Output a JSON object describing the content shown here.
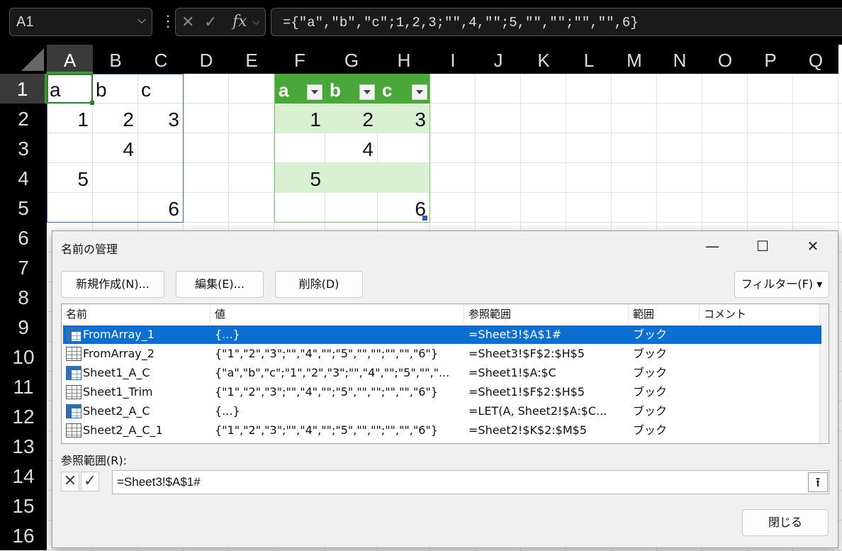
{
  "formula_bar": {
    "name_box": "A1",
    "cancel_icon": "✕",
    "enter_icon": "✓",
    "fx_label": "fx",
    "formula": "={\"a\",\"b\",\"c\";1,2,3;\"\",4,\"\";5,\"\",\"\";\"\",\"\",6}"
  },
  "sheet": {
    "columns": [
      "A",
      "B",
      "C",
      "D",
      "E",
      "F",
      "G",
      "H",
      "I",
      "J",
      "K",
      "L",
      "M",
      "N",
      "O",
      "P",
      "Q"
    ],
    "rows": [
      "1",
      "2",
      "3",
      "4",
      "5",
      "6",
      "7",
      "8",
      "9",
      "10",
      "11",
      "12",
      "13",
      "14",
      "15",
      "16"
    ],
    "spill_cells": {
      "A1": "a",
      "B1": "b",
      "C1": "c",
      "A2": "1",
      "B2": "2",
      "C2": "3",
      "B3": "4",
      "A4": "5",
      "C5": "6"
    },
    "table_headers": [
      "a",
      "b",
      "c"
    ],
    "table_cells": {
      "F2": "1",
      "G2": "2",
      "H2": "3",
      "G3": "4",
      "F4": "5",
      "H5": "6"
    },
    "table_color": "#4aa83a",
    "band_color": "#d9f0d3"
  },
  "dialog": {
    "title": "名前の管理",
    "minimize": "—",
    "maximize": "☐",
    "close": "✕",
    "buttons": {
      "new": "新規作成(N)...",
      "edit": "編集(E)...",
      "delete": "削除(D)",
      "filter": "フィルター(F) ▾"
    },
    "columns": {
      "name": "名前",
      "value": "値",
      "refers_to": "参照範囲",
      "scope": "範囲",
      "comment": "コメント"
    },
    "items": [
      {
        "name": "FromArray_1",
        "value": "{...}",
        "refers_to": "=Sheet3!$A$1#",
        "scope": "ブック",
        "icon": "named-range-icon"
      },
      {
        "name": "FromArray_2",
        "value": "{\"1\",\"2\",\"3\";\"\",\"4\",\"\";\"5\",\"\",\"\";\"\",\"\",\"6\"}",
        "refers_to": "=Sheet3!$F$2:$H$5",
        "scope": "ブック",
        "icon": "table-icon"
      },
      {
        "name": "Sheet1_A_C",
        "value": "{\"a\",\"b\",\"c\";\"1\",\"2\",\"3\";\"\",\"4\",\"\";\"5\",\"\",\"...",
        "refers_to": "=Sheet1!$A:$C",
        "scope": "ブック",
        "icon": "named-range-icon"
      },
      {
        "name": "Sheet1_Trim",
        "value": "{\"1\",\"2\",\"3\";\"\",\"4\",\"\";\"5\",\"\",\"\";\"\",\"\",\"6\"}",
        "refers_to": "=Sheet1!$F$2:$H$5",
        "scope": "ブック",
        "icon": "table-icon"
      },
      {
        "name": "Sheet2_A_C",
        "value": "{...}",
        "refers_to": "=LET(A, Sheet2!$A:$C...",
        "scope": "ブック",
        "icon": "named-range-icon"
      },
      {
        "name": "Sheet2_A_C_1",
        "value": "{\"1\",\"2\",\"3\";\"\",\"4\",\"\";\"5\",\"\",\"\";\"\",\"\",\"6\"}",
        "refers_to": "=Sheet2!$K$2:$M$5",
        "scope": "ブック",
        "icon": "table-icon"
      }
    ],
    "selected_index": 0,
    "refers_to_label": "参照範囲(R):",
    "refers_to_value": "=Sheet3!$A$1#",
    "close_button": "閉じる",
    "selection_color": "#0a6fd1"
  }
}
